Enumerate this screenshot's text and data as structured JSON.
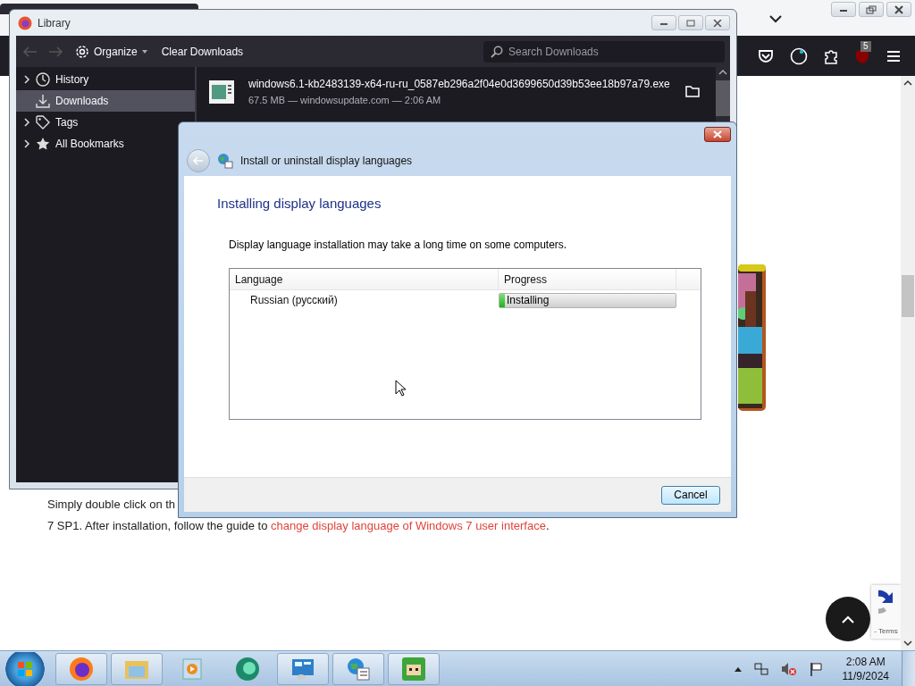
{
  "browser": {
    "extension_badge": "5",
    "page": {
      "line_1": "Simply double click on th",
      "line_2": "7 SP1. After installation, follow the guide to ",
      "link": "change display language of Windows 7 user interface",
      "line_end": "."
    },
    "recaptcha_text": "- Terms"
  },
  "library": {
    "title": "Library",
    "toolbar": {
      "organize": "Organize",
      "clear": "Clear Downloads",
      "search_placeholder": "Search Downloads"
    },
    "sidebar": {
      "items": [
        {
          "label": "History",
          "kind": "folder",
          "selected": false
        },
        {
          "label": "Downloads",
          "kind": "leaf",
          "selected": true
        },
        {
          "label": "Tags",
          "kind": "folder",
          "selected": false
        },
        {
          "label": "All Bookmarks",
          "kind": "folder",
          "selected": false
        }
      ]
    },
    "downloads": [
      {
        "name": "windows6.1-kb2483139-x64-ru-ru_0587eb296a2f04e0d3699650d39b53ee18b97a79.exe",
        "details": "67.5 MB — windowsupdate.com — 2:06 AM"
      }
    ]
  },
  "dialog": {
    "title": "Install or uninstall display languages",
    "heading": "Installing display languages",
    "description": "Display language installation may take a long time on some computers.",
    "table": {
      "columns": [
        "Language",
        "Progress"
      ],
      "rows": [
        {
          "language": "Russian (русский)",
          "status": "Installing",
          "level": 0.03
        }
      ]
    },
    "buttons": [
      "Cancel"
    ]
  },
  "taskbar": {
    "apps": [
      {
        "running": true
      },
      {
        "running": true
      },
      {
        "running": false
      },
      {
        "running": false
      },
      {
        "running": true
      },
      {
        "running": true
      },
      {
        "running": true
      }
    ],
    "clock": {
      "time": "2:08 AM",
      "date": "11/9/2024"
    }
  }
}
